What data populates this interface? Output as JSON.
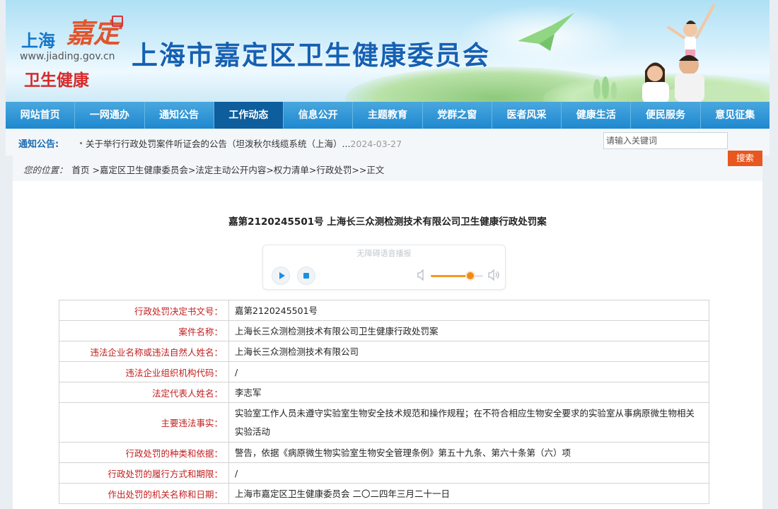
{
  "header": {
    "logo_city": "上海",
    "logo_jiading": "嘉定",
    "logo_url": "www.jiading.gov.cn",
    "logo_health": "卫生健康",
    "site_title": "上海市嘉定区卫生健康委员会"
  },
  "nav": {
    "items": [
      {
        "label": "网站首页"
      },
      {
        "label": "一网通办"
      },
      {
        "label": "通知公告"
      },
      {
        "label": "工作动态"
      },
      {
        "label": "信息公开"
      },
      {
        "label": "主题教育"
      },
      {
        "label": "党群之窗"
      },
      {
        "label": "医者风采"
      },
      {
        "label": "健康生活"
      },
      {
        "label": "便民服务"
      },
      {
        "label": "意见征集"
      }
    ],
    "active": "工作动态"
  },
  "notice": {
    "label": "通知公告:",
    "text": "关于举行行政处罚案件听证会的公告（坦泼秋尔线缆系统（上海）...",
    "date": "2024-03-27"
  },
  "search": {
    "placeholder": "请输入关键词",
    "button": "搜索"
  },
  "breadcrumb": {
    "label": "您的位置：",
    "path": "首页 >嘉定区卫生健康委员会>法定主动公开内容>权力清单>行政处罚>>正文"
  },
  "article": {
    "title": "嘉第2120245501号  上海长三众测检测技术有限公司卫生健康行政处罚案"
  },
  "player": {
    "title": "无障碍语音播报",
    "volume": 0.75
  },
  "table": {
    "rows": [
      {
        "key": "行政处罚决定书文号：",
        "value": "嘉第2120245501号"
      },
      {
        "key": "案件名称：",
        "value": "上海长三众测检测技术有限公司卫生健康行政处罚案"
      },
      {
        "key": "违法企业名称或违法自然人姓名：",
        "value": "上海长三众测检测技术有限公司"
      },
      {
        "key": "违法企业组织机构代码：",
        "value": "/"
      },
      {
        "key": "法定代表人姓名：",
        "value": "李志军"
      },
      {
        "key": "主要违法事实：",
        "value": "实验室工作人员未遵守实验室生物安全技术规范和操作规程；在不符合相应生物安全要求的实验室从事病原微生物相关实验活动"
      },
      {
        "key": "行政处罚的种类和依据：",
        "value": "警告，依据《病原微生物实验室生物安全管理条例》第五十九条、第六十条第（六）项"
      },
      {
        "key": "行政处罚的履行方式和期限：",
        "value": "/"
      },
      {
        "key": "作出处罚的机关名称和日期：",
        "value": "上海市嘉定区卫生健康委员会  二〇二四年三月二十一日"
      }
    ]
  },
  "colors": {
    "nav_bg": "#1e88cf",
    "nav_active": "#0e5d9d",
    "title_blue": "#1561b3",
    "key_red": "#c21e1e",
    "search_orange": "#e8571f"
  }
}
